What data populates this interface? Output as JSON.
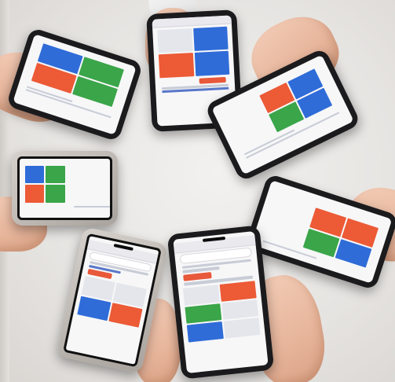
{
  "scene": {
    "description_tag": "",
    "phone_count": 7,
    "colors": {
      "background": "#e6e4e1",
      "tile_green": "#3aa549",
      "tile_blue": "#2f6cd8",
      "tile_orange": "#ec5a36",
      "skin": "#e7b59b"
    }
  }
}
